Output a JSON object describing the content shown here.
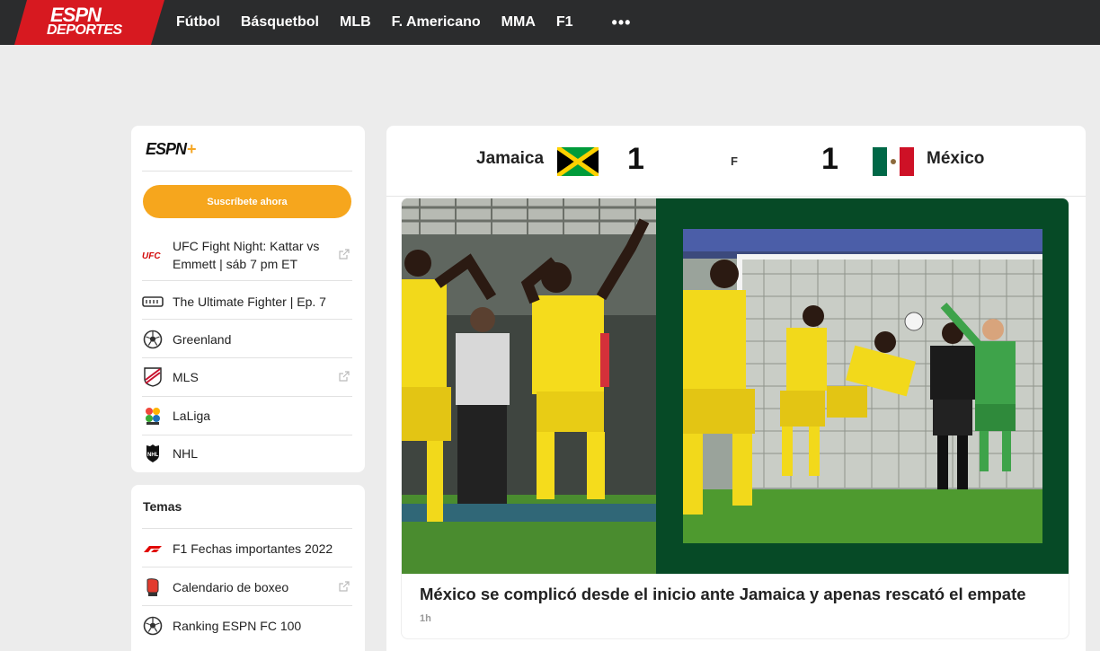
{
  "brand": {
    "logo_top": "ESPN",
    "logo_bottom": "DEPORTES",
    "accent": "#d71920"
  },
  "nav": {
    "items": [
      "Fútbol",
      "Básquetbol",
      "MLB",
      "F. Americano",
      "MMA",
      "F1"
    ],
    "more": "•••"
  },
  "sidebar": {
    "espn_plus": "ESPN",
    "plus_sign": "+",
    "subscribe_label": "Suscríbete ahora",
    "items": [
      {
        "icon": "ufc-icon",
        "label": "UFC Fight Night: Kattar vs Emmett | sáb 7 pm ET",
        "external": true
      },
      {
        "icon": "tuf-icon",
        "label": "The Ultimate Fighter | Ep. 7",
        "external": false
      },
      {
        "icon": "soccer-ball-icon",
        "label": "Greenland",
        "external": false
      },
      {
        "icon": "mls-icon",
        "label": "MLS",
        "external": true
      },
      {
        "icon": "laliga-icon",
        "label": "LaLiga",
        "external": false
      },
      {
        "icon": "nhl-icon",
        "label": "NHL",
        "external": false
      }
    ]
  },
  "temas": {
    "title": "Temas",
    "items": [
      {
        "icon": "f1-icon",
        "label": "F1 Fechas importantes 2022",
        "external": false
      },
      {
        "icon": "boxing-glove-icon",
        "label": "Calendario de boxeo",
        "external": true
      },
      {
        "icon": "soccer-ball-icon",
        "label": "Ranking ESPN FC 100",
        "external": false
      }
    ]
  },
  "match": {
    "home": {
      "name": "Jamaica",
      "score": "1"
    },
    "away": {
      "name": "México",
      "score": "1"
    },
    "status": "F"
  },
  "story": {
    "headline": "México se complicó desde el inicio ante Jamaica y apenas rescató el empate",
    "time": "1h"
  }
}
